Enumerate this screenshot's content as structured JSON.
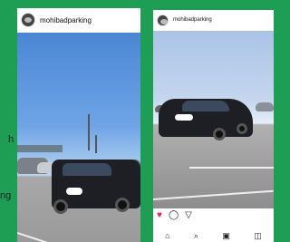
{
  "caption_fragments": [
    "h",
    "ng"
  ],
  "left_post": {
    "username": "mohibadparking",
    "icons": {
      "avatar": "profile-avatar"
    }
  },
  "right_post": {
    "username": "mohibadparking",
    "actions": {
      "like": "♥",
      "comment": "◯",
      "share": "▽"
    },
    "bottom_nav": {
      "home": "⌂",
      "search": "⌕",
      "reels": "▣",
      "shop": "◫"
    }
  }
}
